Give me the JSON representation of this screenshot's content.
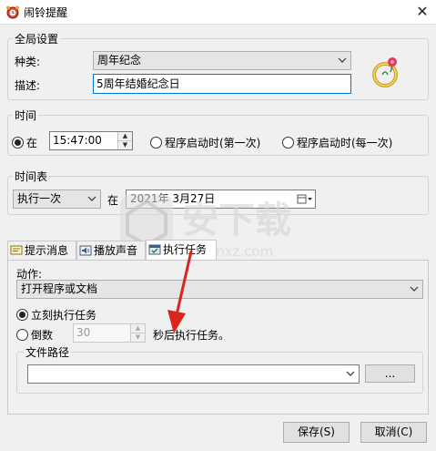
{
  "window": {
    "title": "闹铃提醒",
    "close_glyph": "✕",
    "app_icon": "alarm-clock-icon"
  },
  "global": {
    "label": "全局设置",
    "type_label": "种类:",
    "type_value": "周年纪念",
    "desc_label": "描述:",
    "desc_value": "5周年结婚纪念日",
    "icon": "anniversary-ring-icon"
  },
  "time": {
    "label": "时间",
    "at_label": "在",
    "time_value": "15:47:00",
    "startup_first_label": "程序启动时(第一次)",
    "startup_each_label": "程序启动时(每一次)",
    "selected": "at"
  },
  "schedule": {
    "label": "时间表",
    "freq_value": "执行一次",
    "at_label": "在",
    "date_value": "2021年 3月27日"
  },
  "tabs": [
    {
      "label": "提示消息",
      "icon": "message-icon"
    },
    {
      "label": "播放声音",
      "icon": "speaker-icon"
    },
    {
      "label": "执行任务",
      "icon": "task-icon",
      "active": true
    }
  ],
  "action": {
    "label": "动作:",
    "value": "打开程序或文档",
    "immediate_label": "立刻执行任务",
    "countdown_label": "倒数",
    "countdown_value": "30",
    "after_label": "秒后执行任务。",
    "selected": "immediate",
    "file_path_label": "文件路径",
    "file_path_value": "",
    "browse_label": "..."
  },
  "buttons": {
    "save": "保存(S)",
    "cancel": "取消(C)"
  },
  "watermark": {
    "text": "安下载",
    "sub": "anxz.com"
  },
  "colors": {
    "accent": "#0078d7",
    "arrow": "#d9251c"
  }
}
